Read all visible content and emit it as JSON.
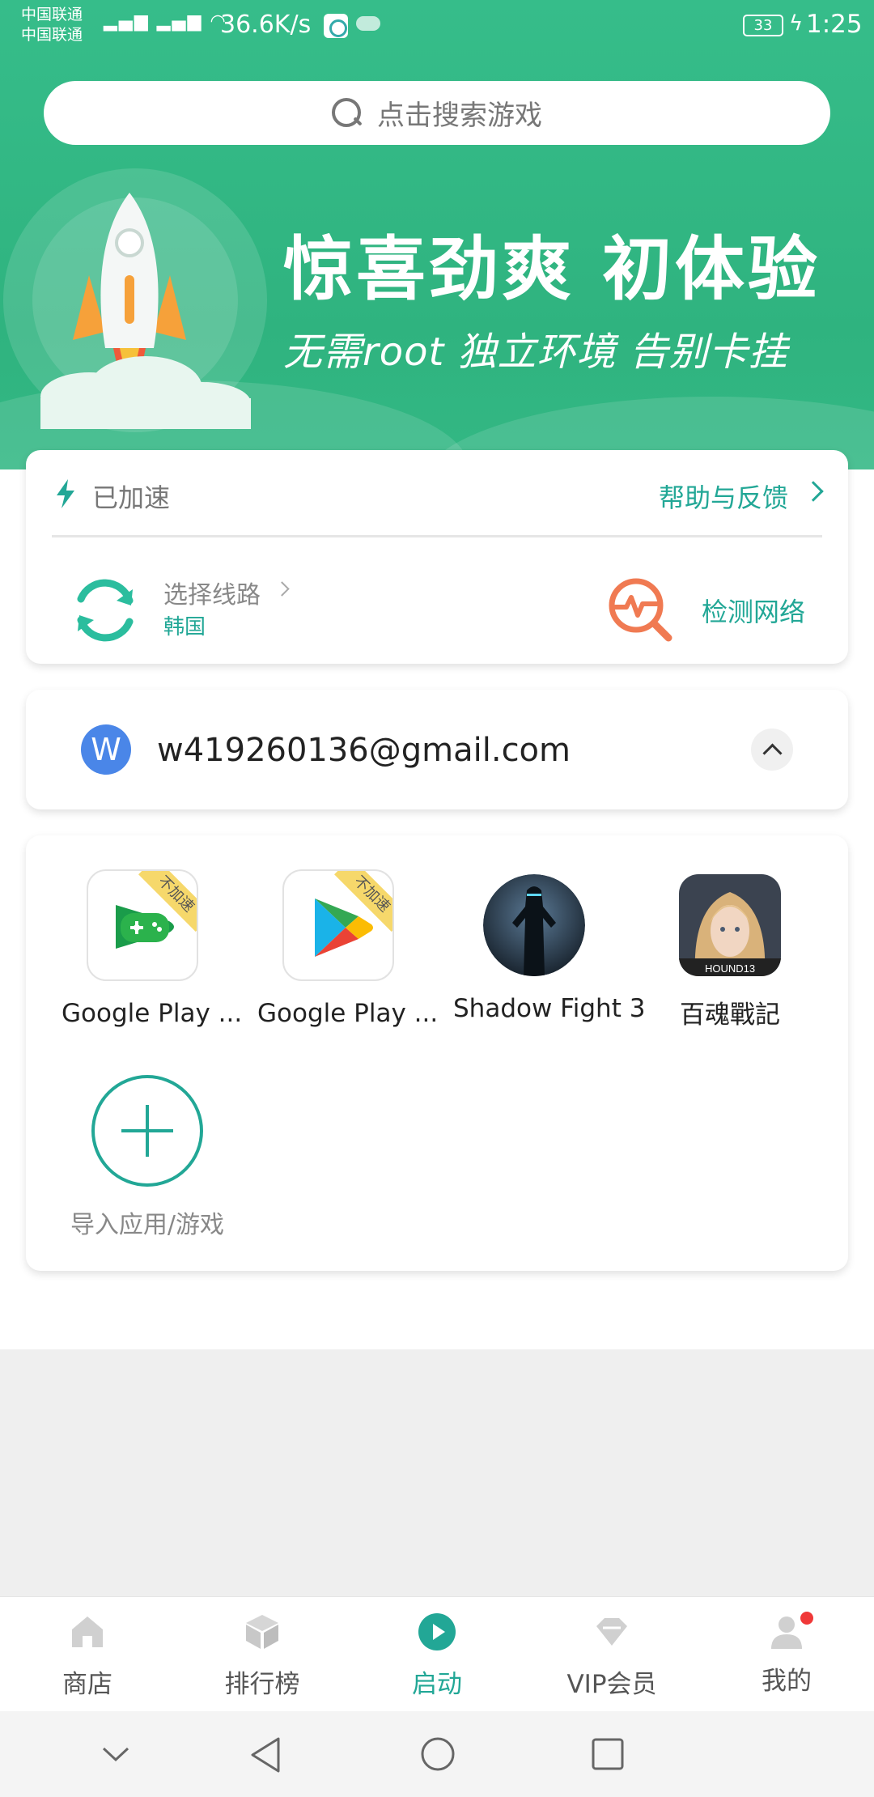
{
  "status_bar": {
    "carrier_1": "中国联通",
    "carrier_2": "中国联通",
    "net_speed": "36.6K/s",
    "battery": "33",
    "time": "1:25"
  },
  "search": {
    "placeholder": "点击搜索游戏"
  },
  "banner": {
    "headline": "惊喜劲爽 初体验",
    "subline": "无需root 独立环境 告别卡挂"
  },
  "accel": {
    "status": "已加速",
    "help": "帮助与反馈",
    "route_label": "选择线路",
    "route_value": "韩国",
    "netcheck": "检测网络"
  },
  "account": {
    "avatar_letter": "W",
    "email": "w419260136@gmail.com"
  },
  "apps": {
    "items": [
      {
        "name": "Google Play ...",
        "badge": "不加速",
        "icon": "google-play-games-icon"
      },
      {
        "name": "Google Play ...",
        "badge": "不加速",
        "icon": "google-play-store-icon"
      },
      {
        "name": "Shadow Fight 3",
        "icon": "shadow-fight-icon"
      },
      {
        "name": "百魂戰記",
        "icon": "hound13-icon"
      }
    ],
    "import_label": "导入应用/游戏"
  },
  "bottom_nav": {
    "items": [
      {
        "label": "商店",
        "icon": "home-icon"
      },
      {
        "label": "排行榜",
        "icon": "cube-icon"
      },
      {
        "label": "启动",
        "icon": "play-icon",
        "active": true
      },
      {
        "label": "VIP会员",
        "icon": "diamond-icon"
      },
      {
        "label": "我的",
        "icon": "user-icon"
      }
    ]
  },
  "colors": {
    "brand_green": "#2fb37f",
    "accent_teal": "#22a796",
    "netcheck_orange": "#f07a52",
    "notify_red": "#f03838"
  }
}
